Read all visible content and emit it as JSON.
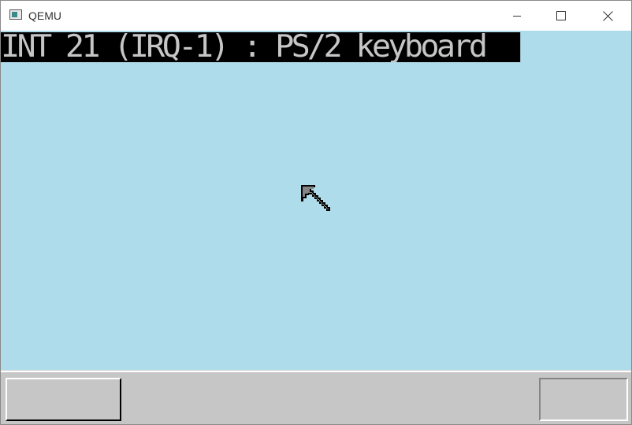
{
  "window": {
    "title": "QEMU",
    "icon": "qemu-app-icon",
    "controls": [
      "minimize-icon",
      "maximize-icon",
      "close-icon"
    ]
  },
  "screen": {
    "background": "#aedceb",
    "console_text": "INT 21 (IRQ-1) : PS/2 keyboard",
    "console_bg": "#000000",
    "console_fg": "#c6c6c6",
    "cursor_icon": "mouse-pointer-icon"
  },
  "taskbar": {
    "background": "#c6c6c6",
    "start_button_label": "",
    "tray_label": ""
  }
}
